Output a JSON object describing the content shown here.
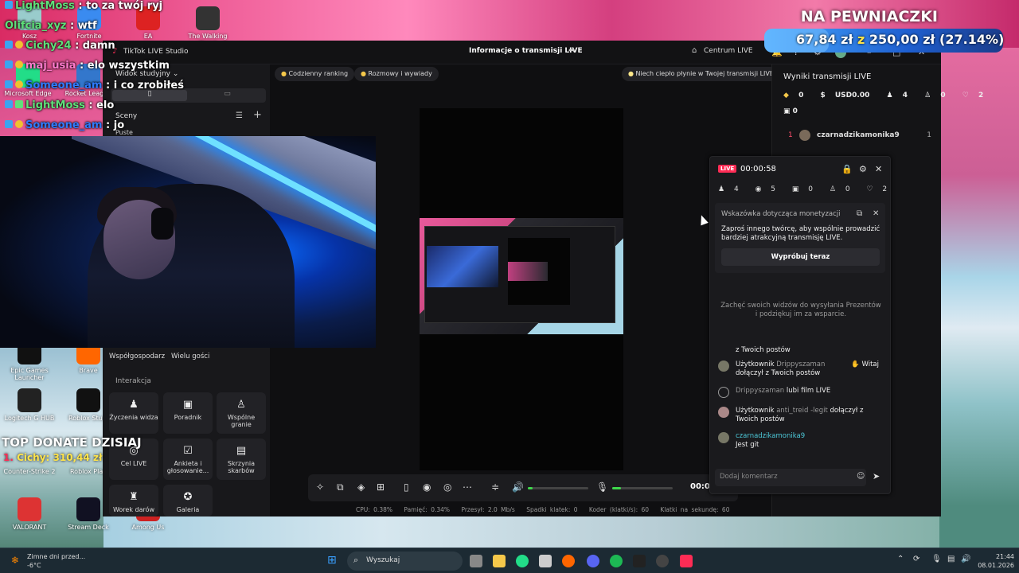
{
  "stream_chat": [
    {
      "user": "LightMoss",
      "text": ": to za twój ryj"
    },
    {
      "user": "Olifcia_xyz",
      "text": ": wtf"
    },
    {
      "user": "Cichy24",
      "text": ": damn"
    },
    {
      "user": "maj_usia",
      "text": ": elo wszystkim"
    },
    {
      "user": "Someone_am",
      "text": ": i co zrobiłeś"
    },
    {
      "user": "LightMoss",
      "text": ": elo"
    },
    {
      "user": "Someone_am",
      "text": ": jo"
    }
  ],
  "desktop_icons": [
    "Kosz",
    "Fortnite",
    "EA",
    "The Walking Dead",
    "Microsoft Edge",
    "Rocket League",
    "Epic Games Launcher",
    "Brave",
    "Logitech G HUB",
    "Roblox Studi",
    "Counter-Strike 2",
    "Roblox Play",
    "VALORANT",
    "Stream Deck",
    "Among Us"
  ],
  "donation_goal": {
    "title": "NA PEWNIACZKI",
    "current": "67,84 zł",
    "sep": "z",
    "target": "250,00 zł",
    "percent": "(27.14%)",
    "progress": 0.2714
  },
  "top_donate": {
    "title": "TOP DONATE DZISIAJ",
    "rank": "1.",
    "name": "Cichy:",
    "amount": "310,44 zł"
  },
  "studio": {
    "app_name": "TikTok LIVE Studio",
    "window_title": "Informacje o transmisji LIVE",
    "center_label": "Centrum LIVE",
    "left": {
      "view_mode": "Widok studyjny",
      "scenes_label": "Sceny",
      "scene_name": "Puste",
      "tiles_top": [
        "Współgospodarz",
        "Wielu gości"
      ],
      "section_interaction": "Interakcja",
      "tiles": [
        {
          "label": "Życzenia widza",
          "icon": "wish-icon"
        },
        {
          "label": "Poradnik",
          "icon": "guide-icon"
        },
        {
          "label": "Wspólne granie",
          "icon": "play-together-icon"
        },
        {
          "label": "Cel LIVE",
          "icon": "target-icon"
        },
        {
          "label": "Ankieta i głosowanie...",
          "icon": "poll-icon"
        },
        {
          "label": "Skrzynia skarbów",
          "icon": "chest-icon"
        },
        {
          "label": "Worek darów",
          "icon": "bag-icon"
        },
        {
          "label": "Galeria",
          "icon": "gallery-icon"
        }
      ]
    },
    "chips": [
      "Codzienny ranking",
      "Rozmowy i wywiady",
      "Niech ciepło płynie w Twojej transmisji LIVE"
    ],
    "controls_time": "00:00:58",
    "volume_level": 0.08,
    "mic_level": 0.15,
    "stats": [
      "CPU: 0.38%",
      "Pamięć: 0.34%",
      "Przesył: 2.0 Mb/s",
      "Spadki klatek: 0",
      "Koder (klatki/s): 60",
      "Klatki na sekundę: 60"
    ],
    "right": {
      "title": "Wyniki transmisji LIVE",
      "metrics": [
        "0",
        "USD0.00",
        "4",
        "0",
        "2"
      ],
      "gifts": "0",
      "ranking": [
        {
          "rank": "1",
          "name": "czarnadzikamonika9",
          "score": "1"
        }
      ]
    },
    "live_panel": {
      "badge": "LIVE",
      "time": "00:00:58",
      "metrics": [
        "4",
        "5",
        "0",
        "0",
        "2"
      ],
      "tip_header": "Wskazówka dotycząca monetyzacji",
      "tip_body": "Zaproś innego twórcę, aby wspólnie prowadzić bardziej atrakcyjną transmisję LIVE.",
      "tip_button": "Wypróbuj teraz",
      "encourage": "Zachęć swoich widzów do wysyłania Prezentów i podziękuj im za wsparcie.",
      "partial": "z Twoich postów",
      "messages": [
        {
          "pre": "Użytkownik",
          "user": "Drippyszaman",
          "text": "dołączył z Twoich postów",
          "action": "Witaj"
        },
        {
          "pre": "",
          "user": "Drippyszaman",
          "text": "lubi film LIVE",
          "action": ""
        },
        {
          "pre": "Użytkownik",
          "user": "anti_treid -legit",
          "text": "dołączył z Twoich postów",
          "action": ""
        },
        {
          "pre": "",
          "user": "czarnadzikamonika9",
          "text": "Jest git",
          "action": ""
        }
      ],
      "comment_placeholder": "Dodaj komentarz"
    }
  },
  "taskbar": {
    "search": "Wyszukaj",
    "weather_title": "Zimne dni przed...",
    "weather_temp": "-6°C",
    "time": "21:44",
    "date": "08.01.2026"
  }
}
